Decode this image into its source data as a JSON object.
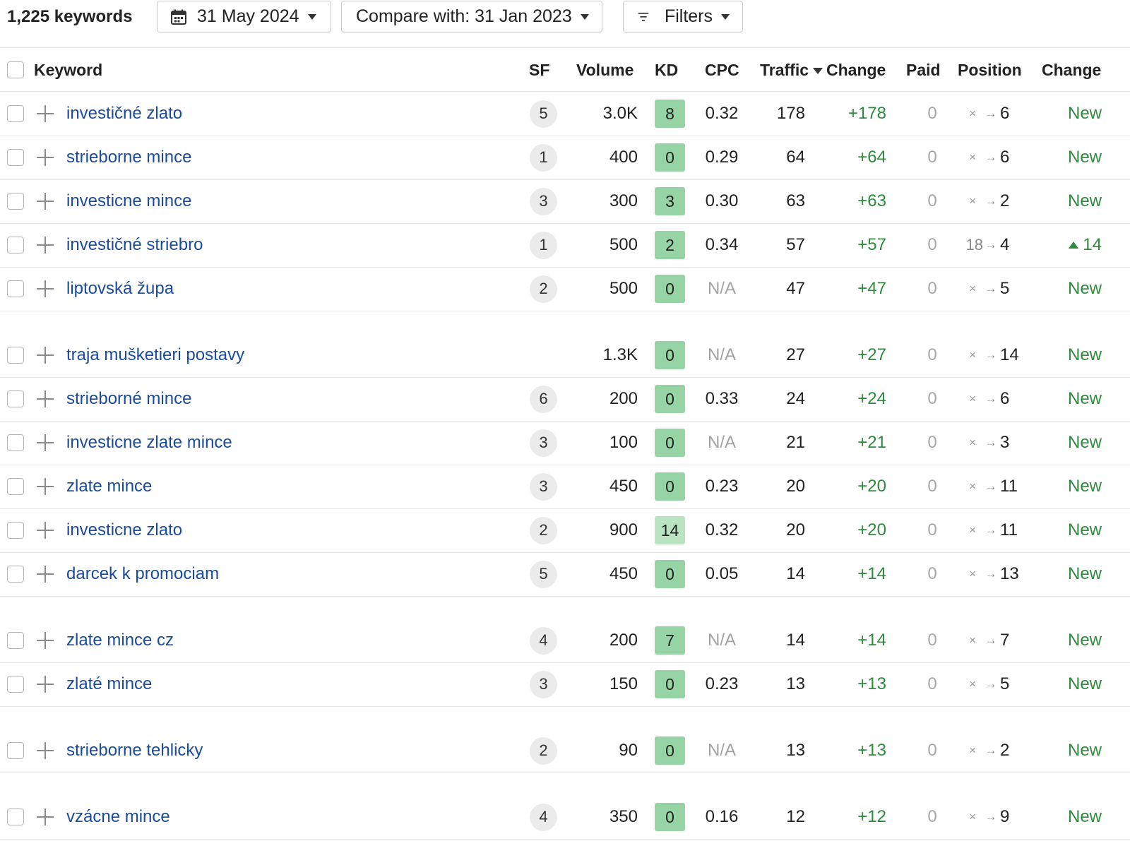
{
  "toolbar": {
    "keyword_count": "1,225 keywords",
    "date_label": "31 May 2024",
    "compare_label": "Compare with: 31 Jan 2023",
    "filters_label": "Filters"
  },
  "columns": {
    "keyword": "Keyword",
    "sf": "SF",
    "volume": "Volume",
    "kd": "KD",
    "cpc": "CPC",
    "traffic": "Traffic",
    "traffic_change": "Change",
    "paid": "Paid",
    "position": "Position",
    "position_change": "Change"
  },
  "colors": {
    "link": "#1a4b9e",
    "positive": "#2e8b3d",
    "kd_easy": "#96d3a5",
    "kd_medium": "#b9e3c1"
  },
  "rows": [
    {
      "keyword": "investičné zlato",
      "sf": "5",
      "volume": "3.0K",
      "kd": "8",
      "cpc": "0.32",
      "traffic": "178",
      "traffic_change": "+178",
      "paid": "0",
      "pos_from": "×",
      "pos_to": "6",
      "pos_change": "New"
    },
    {
      "keyword": "strieborne mince",
      "sf": "1",
      "volume": "400",
      "kd": "0",
      "cpc": "0.29",
      "traffic": "64",
      "traffic_change": "+64",
      "paid": "0",
      "pos_from": "×",
      "pos_to": "6",
      "pos_change": "New"
    },
    {
      "keyword": "investicne mince",
      "sf": "3",
      "volume": "300",
      "kd": "3",
      "cpc": "0.30",
      "traffic": "63",
      "traffic_change": "+63",
      "paid": "0",
      "pos_from": "×",
      "pos_to": "2",
      "pos_change": "New"
    },
    {
      "keyword": "investičné striebro",
      "sf": "1",
      "volume": "500",
      "kd": "2",
      "cpc": "0.34",
      "traffic": "57",
      "traffic_change": "+57",
      "paid": "0",
      "pos_from": "18",
      "pos_to": "4",
      "pos_change": "14"
    },
    {
      "keyword": "liptovská župa",
      "sf": "2",
      "volume": "500",
      "kd": "0",
      "cpc": "N/A",
      "traffic": "47",
      "traffic_change": "+47",
      "paid": "0",
      "pos_from": "×",
      "pos_to": "5",
      "pos_change": "New"
    },
    {
      "keyword": "traja mušketieri postavy",
      "sf": "",
      "volume": "1.3K",
      "kd": "0",
      "cpc": "N/A",
      "traffic": "27",
      "traffic_change": "+27",
      "paid": "0",
      "pos_from": "×",
      "pos_to": "14",
      "pos_change": "New"
    },
    {
      "keyword": "strieborné mince",
      "sf": "6",
      "volume": "200",
      "kd": "0",
      "cpc": "0.33",
      "traffic": "24",
      "traffic_change": "+24",
      "paid": "0",
      "pos_from": "×",
      "pos_to": "6",
      "pos_change": "New"
    },
    {
      "keyword": "investicne zlate mince",
      "sf": "3",
      "volume": "100",
      "kd": "0",
      "cpc": "N/A",
      "traffic": "21",
      "traffic_change": "+21",
      "paid": "0",
      "pos_from": "×",
      "pos_to": "3",
      "pos_change": "New"
    },
    {
      "keyword": "zlate mince",
      "sf": "3",
      "volume": "450",
      "kd": "0",
      "cpc": "0.23",
      "traffic": "20",
      "traffic_change": "+20",
      "paid": "0",
      "pos_from": "×",
      "pos_to": "11",
      "pos_change": "New"
    },
    {
      "keyword": "investicne zlato",
      "sf": "2",
      "volume": "900",
      "kd": "14",
      "cpc": "0.32",
      "traffic": "20",
      "traffic_change": "+20",
      "paid": "0",
      "pos_from": "×",
      "pos_to": "11",
      "pos_change": "New"
    },
    {
      "keyword": "darcek k promociam",
      "sf": "5",
      "volume": "450",
      "kd": "0",
      "cpc": "0.05",
      "traffic": "14",
      "traffic_change": "+14",
      "paid": "0",
      "pos_from": "×",
      "pos_to": "13",
      "pos_change": "New"
    },
    {
      "keyword": "zlate mince cz",
      "sf": "4",
      "volume": "200",
      "kd": "7",
      "cpc": "N/A",
      "traffic": "14",
      "traffic_change": "+14",
      "paid": "0",
      "pos_from": "×",
      "pos_to": "7",
      "pos_change": "New"
    },
    {
      "keyword": "zlaté mince",
      "sf": "3",
      "volume": "150",
      "kd": "0",
      "cpc": "0.23",
      "traffic": "13",
      "traffic_change": "+13",
      "paid": "0",
      "pos_from": "×",
      "pos_to": "5",
      "pos_change": "New"
    },
    {
      "keyword": "strieborne tehlicky",
      "sf": "2",
      "volume": "90",
      "kd": "0",
      "cpc": "N/A",
      "traffic": "13",
      "traffic_change": "+13",
      "paid": "0",
      "pos_from": "×",
      "pos_to": "2",
      "pos_change": "New"
    },
    {
      "keyword": "vzácne mince",
      "sf": "4",
      "volume": "350",
      "kd": "0",
      "cpc": "0.16",
      "traffic": "12",
      "traffic_change": "+12",
      "paid": "0",
      "pos_from": "×",
      "pos_to": "9",
      "pos_change": "New"
    }
  ]
}
